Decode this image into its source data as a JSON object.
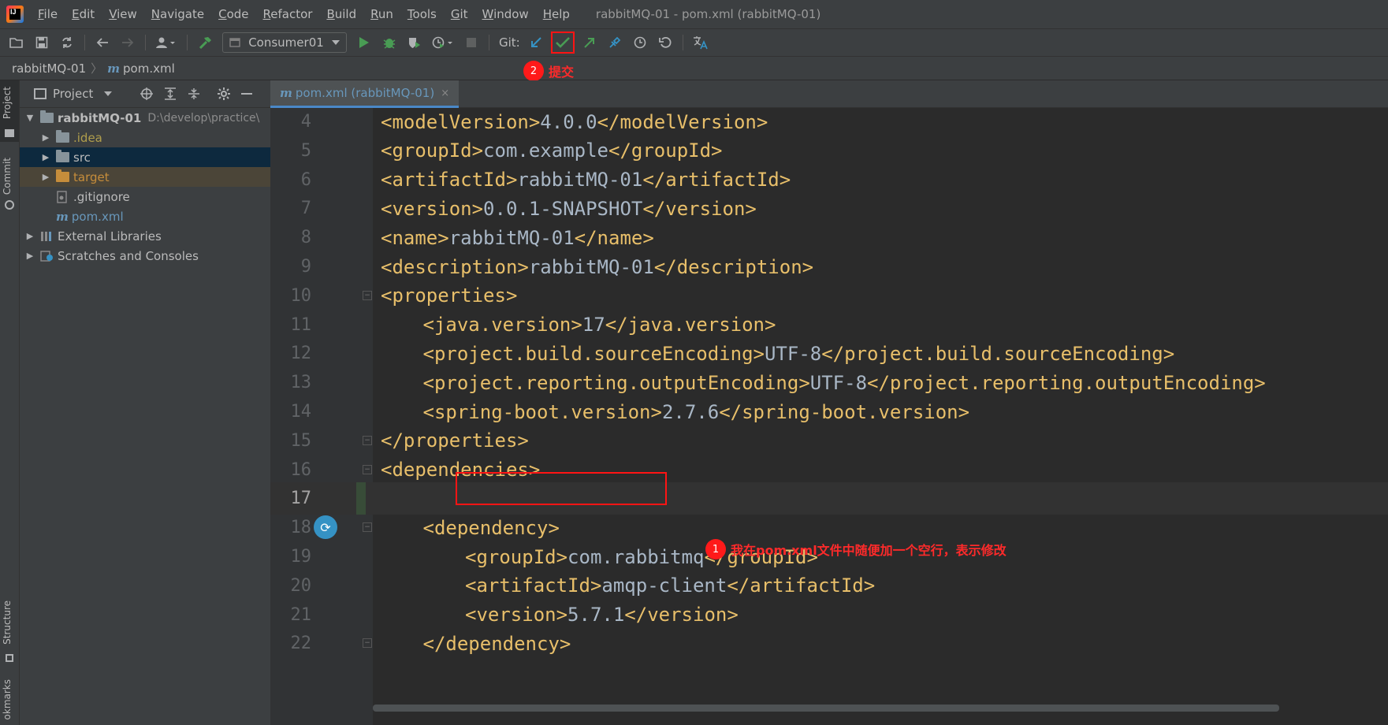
{
  "menu": {
    "app_icon": "intellij-idea-icon",
    "items": [
      {
        "label": "File",
        "u": "F",
        "rest": "ile"
      },
      {
        "label": "Edit",
        "u": "E",
        "rest": "dit"
      },
      {
        "label": "View",
        "u": "V",
        "rest": "iew"
      },
      {
        "label": "Navigate",
        "u": "N",
        "rest": "avigate"
      },
      {
        "label": "Code",
        "u": "C",
        "rest": "ode"
      },
      {
        "label": "Refactor",
        "u": "R",
        "rest": "efactor"
      },
      {
        "label": "Build",
        "u": "B",
        "rest": "uild"
      },
      {
        "label": "Run",
        "u": "R",
        "rest": "un"
      },
      {
        "label": "Tools",
        "u": "T",
        "rest": "ools"
      },
      {
        "label": "Git",
        "u": "G",
        "rest": "it"
      },
      {
        "label": "Window",
        "u": "W",
        "rest": "indow"
      },
      {
        "label": "Help",
        "u": "H",
        "rest": "elp"
      }
    ],
    "window_title": "rabbitMQ-01 - pom.xml (rabbitMQ-01)"
  },
  "toolbar": {
    "run_config": "Consumer01",
    "git_label": "Git:"
  },
  "breadcrumb": {
    "project": "rabbitMQ-01",
    "separator": "〉",
    "file_icon": "m",
    "file": "pom.xml"
  },
  "annotations": {
    "commit_number": "2",
    "commit_text": "提交",
    "edit_number": "1",
    "edit_text": "我在pom.xml文件中随便加一个空行，表示修改"
  },
  "side_tabs": {
    "project": "Project",
    "commit": "Commit",
    "structure": "Structure",
    "bookmarks": "okmarks"
  },
  "project_panel": {
    "title": "Project",
    "tree": [
      {
        "label": "rabbitMQ-01",
        "path": "D:\\develop\\practice\\"
      },
      {
        "label": ".idea"
      },
      {
        "label": "src"
      },
      {
        "label": "target"
      },
      {
        "label": ".gitignore"
      },
      {
        "label": "pom.xml",
        "icon": "m"
      },
      {
        "label": "External Libraries"
      },
      {
        "label": "Scratches and Consoles"
      }
    ]
  },
  "editor_tab": {
    "icon": "m",
    "label": "pom.xml (rabbitMQ-01)",
    "close": "×"
  },
  "code_lines": [
    {
      "n": "4",
      "tag": "<modelVersion>",
      "text": "4.0.0",
      "end": "</modelVersion>"
    },
    {
      "n": "5",
      "tag": "<groupId>",
      "text": "com.example",
      "end": "</groupId>"
    },
    {
      "n": "6",
      "tag": "<artifactId>",
      "text": "rabbitMQ-01",
      "end": "</artifactId>"
    },
    {
      "n": "7",
      "tag": "<version>",
      "text": "0.0.1-SNAPSHOT",
      "end": "</version>"
    },
    {
      "n": "8",
      "tag": "<name>",
      "text": "rabbitMQ-01",
      "end": "</name>"
    },
    {
      "n": "9",
      "tag": "<description>",
      "text": "rabbitMQ-01",
      "end": "</description>"
    },
    {
      "n": "10",
      "tag": "<properties>",
      "text": "",
      "end": ""
    },
    {
      "n": "11",
      "tag": "<java.version>",
      "text": "17",
      "end": "</java.version>"
    },
    {
      "n": "12",
      "tag": "<project.build.sourceEncoding>",
      "text": "UTF-8",
      "end": "</project.build.sourceEncoding>"
    },
    {
      "n": "13",
      "tag": "<project.reporting.outputEncoding>",
      "text": "UTF-8",
      "end": "</project.reporting.outputEncoding>"
    },
    {
      "n": "14",
      "tag": "<spring-boot.version>",
      "text": "2.7.6",
      "end": "</spring-boot.version>"
    },
    {
      "n": "15",
      "tag": "</properties>",
      "text": "",
      "end": ""
    },
    {
      "n": "16",
      "tag": "<dependencies>",
      "text": "",
      "end": ""
    },
    {
      "n": "17",
      "tag": "",
      "text": "",
      "end": ""
    },
    {
      "n": "18",
      "tag": "<dependency>",
      "text": "",
      "end": ""
    },
    {
      "n": "19",
      "tag": "<groupId>",
      "text": "com.rabbitmq",
      "end": "</groupId>"
    },
    {
      "n": "20",
      "tag": "<artifactId>",
      "text": "amqp-client",
      "end": "</artifactId>"
    },
    {
      "n": "21",
      "tag": "<version>",
      "text": "5.7.1",
      "end": "</version>"
    },
    {
      "n": "22",
      "tag": "</dependency>",
      "text": "",
      "end": ""
    }
  ],
  "colors": {
    "tag": "#e8bf6a",
    "text": "#a9b7c6",
    "annotation_red": "#ff1414"
  }
}
